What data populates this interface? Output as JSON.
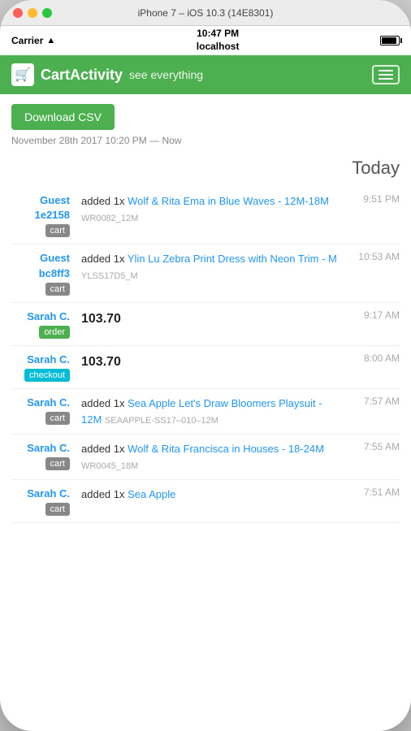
{
  "device": {
    "title": "iPhone 7 – iOS 10.3 (14E8301)"
  },
  "status_bar": {
    "carrier": "Carrier",
    "time": "10:47 PM",
    "location": "localhost"
  },
  "nav": {
    "icon": "🛒",
    "app_name": "CartActivity",
    "subtitle": "see everything",
    "menu_label": "menu"
  },
  "toolbar": {
    "download_csv_label": "Download CSV",
    "date_range": "November 28th 2017 10:20 PM — Now"
  },
  "section": {
    "today_label": "Today"
  },
  "activities": [
    {
      "user": "Guest 1e2158",
      "badge": "cart",
      "badge_type": "cart",
      "action": "added 1x ",
      "product": "Wolf & Rita Ema in Blue Waves - 12M-18M",
      "sku": "WR0082_12M",
      "time": "9:51 PM",
      "amount": ""
    },
    {
      "user": "Guest bc8ff3",
      "badge": "cart",
      "badge_type": "cart",
      "action": "added 1x ",
      "product": "Ylin Lu Zebra Print Dress with Neon Trim - M",
      "sku": "YLSS17D5_M",
      "time": "10:53 AM",
      "amount": ""
    },
    {
      "user": "Sarah C.",
      "badge": "order",
      "badge_type": "order",
      "action": "",
      "product": "",
      "sku": "",
      "time": "9:17 AM",
      "amount": "103.70"
    },
    {
      "user": "Sarah C.",
      "badge": "checkout",
      "badge_type": "checkout",
      "action": "",
      "product": "",
      "sku": "",
      "time": "8:00 AM",
      "amount": "103.70"
    },
    {
      "user": "Sarah C.",
      "badge": "cart",
      "badge_type": "cart",
      "action": "added 1x ",
      "product": "Sea Apple Let's Draw Bloomers Playsuit - 12M",
      "sku": "SEAAPPLE-SS17-010-12M",
      "time": "7:57 AM",
      "amount": ""
    },
    {
      "user": "Sarah C.",
      "badge": "cart",
      "badge_type": "cart",
      "action": "added 1x ",
      "product": "Wolf & Rita Francisca in Houses - 18-24M",
      "sku": "WR0045_18M",
      "time": "7:55 AM",
      "amount": ""
    },
    {
      "user": "Sarah C.",
      "badge": "cart",
      "badge_type": "cart",
      "action": "added 1x ",
      "product": "Sea Apple",
      "sku": "",
      "time": "7:51 AM",
      "amount": ""
    }
  ]
}
